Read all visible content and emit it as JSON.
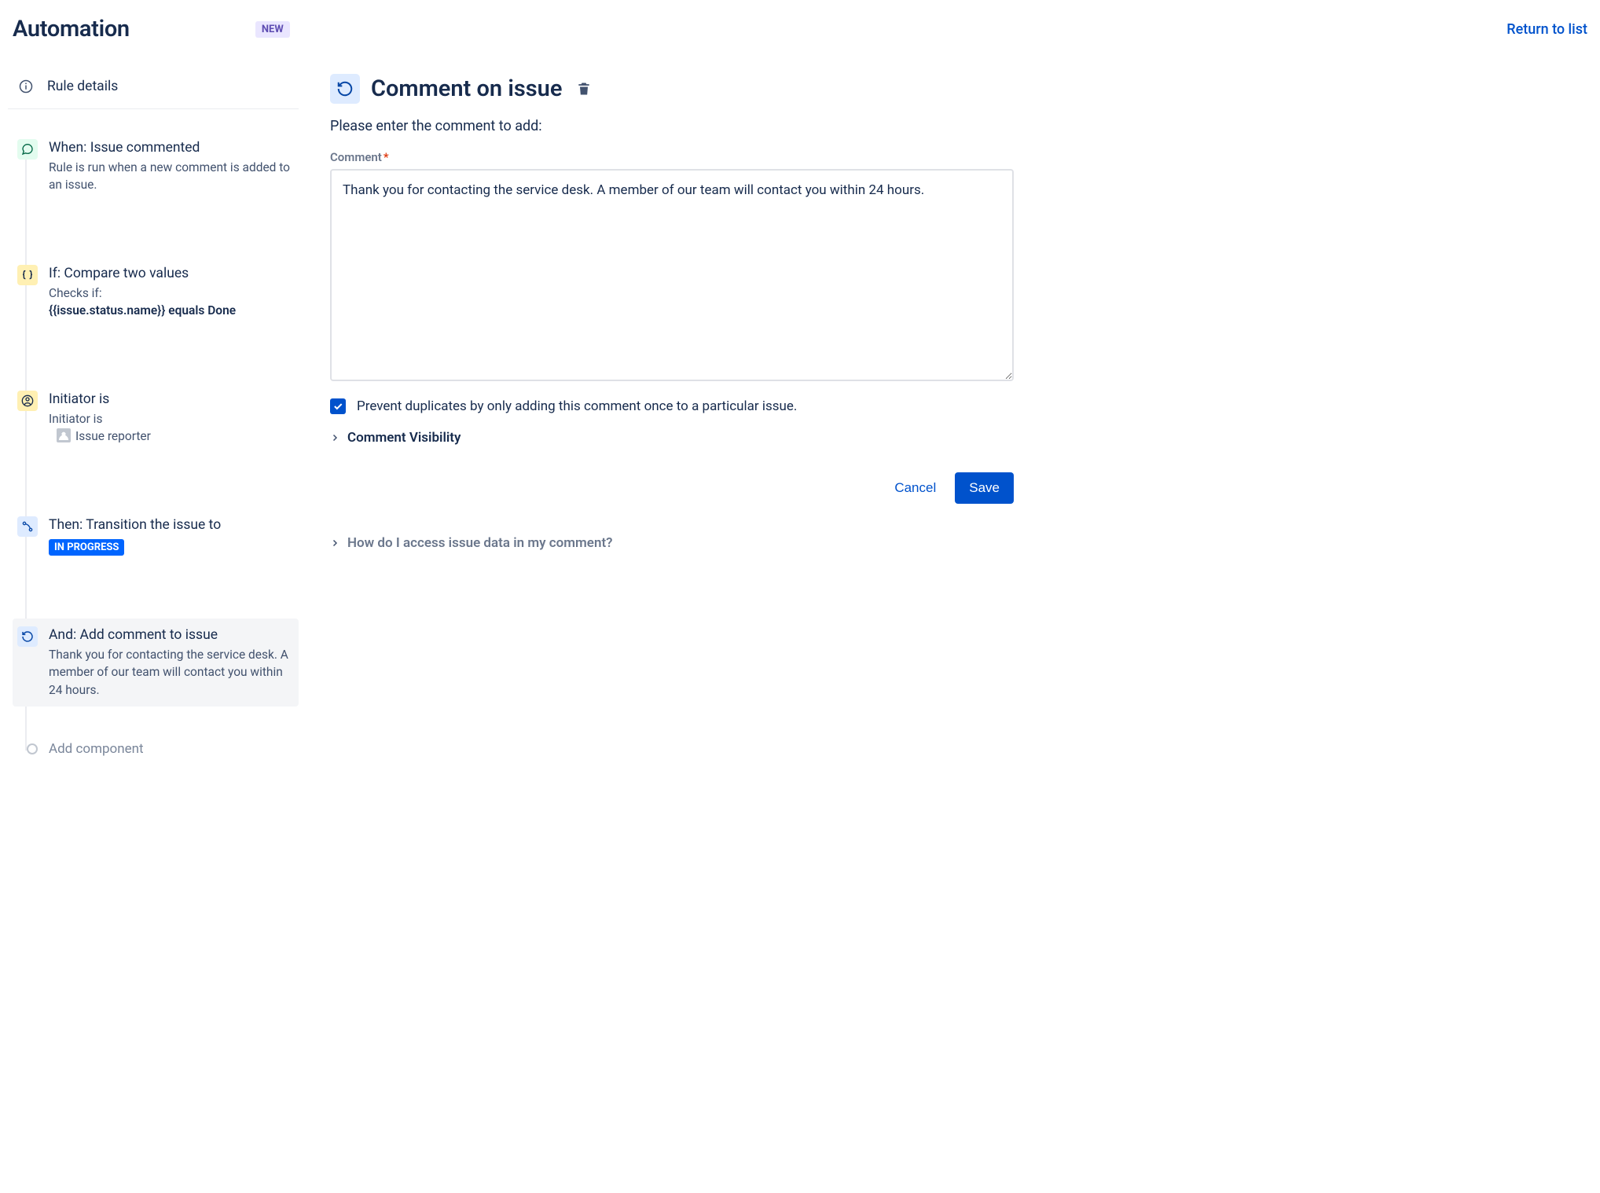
{
  "header": {
    "title": "Automation",
    "badge": "NEW",
    "return_link": "Return to list"
  },
  "sidebar": {
    "rule_details_label": "Rule details",
    "steps": {
      "trigger": {
        "title": "When: Issue commented",
        "desc": "Rule is run when a new comment is added to an issue."
      },
      "condition_compare": {
        "title": "If: Compare two values",
        "desc_prefix": "Checks if:",
        "desc_bold": "{{issue.status.name}} equals Done"
      },
      "condition_initiator": {
        "title": "Initiator is",
        "desc_prefix": "Initiator is",
        "desc_value": "Issue reporter"
      },
      "action_transition": {
        "title": "Then: Transition the issue to",
        "status": "IN PROGRESS"
      },
      "action_comment": {
        "title": "And: Add comment to issue",
        "desc": "Thank you for contacting the service desk. A member of our team will contact you within 24 hours."
      }
    },
    "add_component_label": "Add component"
  },
  "panel": {
    "title": "Comment on issue",
    "description": "Please enter the comment to add:",
    "comment_label": "Comment",
    "comment_value": "Thank you for contacting the service desk. A member of our team will contact you within 24 hours.",
    "checkbox_label": "Prevent duplicates by only adding this comment once to a particular issue.",
    "checkbox_checked": true,
    "visibility_label": "Comment Visibility",
    "help_label": "How do I access issue data in my comment?",
    "cancel_label": "Cancel",
    "save_label": "Save"
  }
}
